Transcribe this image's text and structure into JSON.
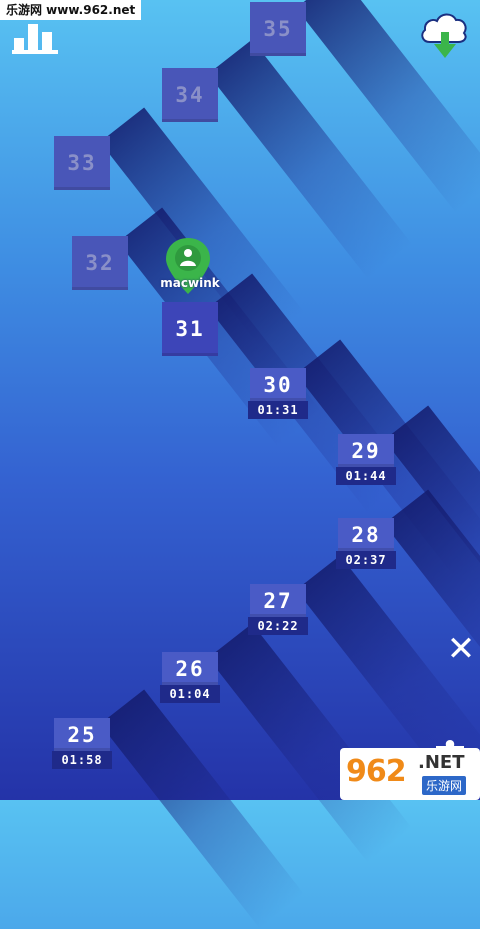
{
  "watermark": {
    "top_text": "乐游网 www.962.net",
    "logo_number": "962",
    "logo_suffix": ".NET",
    "logo_sub": "乐游网"
  },
  "icons": {
    "stats": "bar-chart-icon",
    "cloud": "cloud-download-icon",
    "close": "close-icon",
    "location": "location-pin-icon",
    "puzzle": "puzzle-icon"
  },
  "player": {
    "name": "macwink"
  },
  "close_glyph": "✕",
  "levels": [
    {
      "number": "35",
      "state": "locked",
      "time": ""
    },
    {
      "number": "34",
      "state": "locked",
      "time": ""
    },
    {
      "number": "33",
      "state": "locked",
      "time": ""
    },
    {
      "number": "32",
      "state": "locked",
      "time": ""
    },
    {
      "number": "31",
      "state": "current",
      "time": ""
    },
    {
      "number": "30",
      "state": "completed",
      "time": "01:31"
    },
    {
      "number": "29",
      "state": "completed",
      "time": "01:44"
    },
    {
      "number": "28",
      "state": "completed",
      "time": "02:37"
    },
    {
      "number": "27",
      "state": "completed",
      "time": "02:22"
    },
    {
      "number": "26",
      "state": "completed",
      "time": "01:04"
    },
    {
      "number": "25",
      "state": "completed",
      "time": "01:58"
    }
  ],
  "colors": {
    "background_top": "#58c2f2",
    "background_bottom": "#2433a8",
    "tile": "#4a5bc6",
    "time_badge": "#1f2a8a",
    "pin": "#3bb54a"
  }
}
